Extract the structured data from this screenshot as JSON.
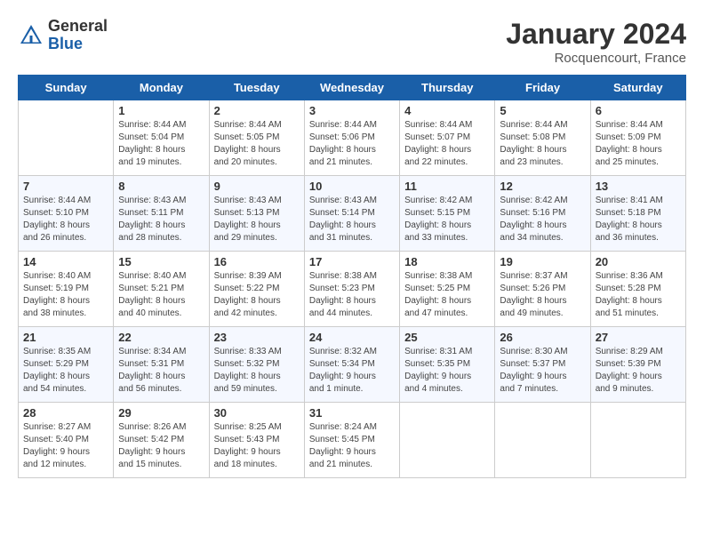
{
  "logo": {
    "general": "General",
    "blue": "Blue"
  },
  "title": "January 2024",
  "location": "Rocquencourt, France",
  "days_of_week": [
    "Sunday",
    "Monday",
    "Tuesday",
    "Wednesday",
    "Thursday",
    "Friday",
    "Saturday"
  ],
  "weeks": [
    [
      {
        "day": "",
        "info": ""
      },
      {
        "day": "1",
        "info": "Sunrise: 8:44 AM\nSunset: 5:04 PM\nDaylight: 8 hours\nand 19 minutes."
      },
      {
        "day": "2",
        "info": "Sunrise: 8:44 AM\nSunset: 5:05 PM\nDaylight: 8 hours\nand 20 minutes."
      },
      {
        "day": "3",
        "info": "Sunrise: 8:44 AM\nSunset: 5:06 PM\nDaylight: 8 hours\nand 21 minutes."
      },
      {
        "day": "4",
        "info": "Sunrise: 8:44 AM\nSunset: 5:07 PM\nDaylight: 8 hours\nand 22 minutes."
      },
      {
        "day": "5",
        "info": "Sunrise: 8:44 AM\nSunset: 5:08 PM\nDaylight: 8 hours\nand 23 minutes."
      },
      {
        "day": "6",
        "info": "Sunrise: 8:44 AM\nSunset: 5:09 PM\nDaylight: 8 hours\nand 25 minutes."
      }
    ],
    [
      {
        "day": "7",
        "info": ""
      },
      {
        "day": "8",
        "info": "Sunrise: 8:43 AM\nSunset: 5:11 PM\nDaylight: 8 hours\nand 28 minutes."
      },
      {
        "day": "9",
        "info": "Sunrise: 8:43 AM\nSunset: 5:13 PM\nDaylight: 8 hours\nand 29 minutes."
      },
      {
        "day": "10",
        "info": "Sunrise: 8:43 AM\nSunset: 5:14 PM\nDaylight: 8 hours\nand 31 minutes."
      },
      {
        "day": "11",
        "info": "Sunrise: 8:42 AM\nSunset: 5:15 PM\nDaylight: 8 hours\nand 33 minutes."
      },
      {
        "day": "12",
        "info": "Sunrise: 8:42 AM\nSunset: 5:16 PM\nDaylight: 8 hours\nand 34 minutes."
      },
      {
        "day": "13",
        "info": "Sunrise: 8:41 AM\nSunset: 5:18 PM\nDaylight: 8 hours\nand 36 minutes."
      }
    ],
    [
      {
        "day": "14",
        "info": ""
      },
      {
        "day": "15",
        "info": "Sunrise: 8:40 AM\nSunset: 5:21 PM\nDaylight: 8 hours\nand 40 minutes."
      },
      {
        "day": "16",
        "info": "Sunrise: 8:39 AM\nSunset: 5:22 PM\nDaylight: 8 hours\nand 42 minutes."
      },
      {
        "day": "17",
        "info": "Sunrise: 8:38 AM\nSunset: 5:23 PM\nDaylight: 8 hours\nand 44 minutes."
      },
      {
        "day": "18",
        "info": "Sunrise: 8:38 AM\nSunset: 5:25 PM\nDaylight: 8 hours\nand 47 minutes."
      },
      {
        "day": "19",
        "info": "Sunrise: 8:37 AM\nSunset: 5:26 PM\nDaylight: 8 hours\nand 49 minutes."
      },
      {
        "day": "20",
        "info": "Sunrise: 8:36 AM\nSunset: 5:28 PM\nDaylight: 8 hours\nand 51 minutes."
      }
    ],
    [
      {
        "day": "21",
        "info": ""
      },
      {
        "day": "22",
        "info": "Sunrise: 8:34 AM\nSunset: 5:31 PM\nDaylight: 8 hours\nand 56 minutes."
      },
      {
        "day": "23",
        "info": "Sunrise: 8:33 AM\nSunset: 5:32 PM\nDaylight: 8 hours\nand 59 minutes."
      },
      {
        "day": "24",
        "info": "Sunrise: 8:32 AM\nSunset: 5:34 PM\nDaylight: 9 hours\nand 1 minute."
      },
      {
        "day": "25",
        "info": "Sunrise: 8:31 AM\nSunset: 5:35 PM\nDaylight: 9 hours\nand 4 minutes."
      },
      {
        "day": "26",
        "info": "Sunrise: 8:30 AM\nSunset: 5:37 PM\nDaylight: 9 hours\nand 7 minutes."
      },
      {
        "day": "27",
        "info": "Sunrise: 8:29 AM\nSunset: 5:39 PM\nDaylight: 9 hours\nand 9 minutes."
      }
    ],
    [
      {
        "day": "28",
        "info": "Sunrise: 8:27 AM\nSunset: 5:40 PM\nDaylight: 9 hours\nand 12 minutes."
      },
      {
        "day": "29",
        "info": "Sunrise: 8:26 AM\nSunset: 5:42 PM\nDaylight: 9 hours\nand 15 minutes."
      },
      {
        "day": "30",
        "info": "Sunrise: 8:25 AM\nSunset: 5:43 PM\nDaylight: 9 hours\nand 18 minutes."
      },
      {
        "day": "31",
        "info": "Sunrise: 8:24 AM\nSunset: 5:45 PM\nDaylight: 9 hours\nand 21 minutes."
      },
      {
        "day": "",
        "info": ""
      },
      {
        "day": "",
        "info": ""
      },
      {
        "day": "",
        "info": ""
      }
    ]
  ],
  "week7_day14_info": "Sunrise: 8:40 AM\nSunset: 5:19 PM\nDaylight: 8 hours\nand 38 minutes.",
  "week7_day21_info": "Sunrise: 8:35 AM\nSunset: 5:29 PM\nDaylight: 8 hours\nand 54 minutes.",
  "week2_day7_info": "Sunrise: 8:44 AM\nSunset: 5:10 PM\nDaylight: 8 hours\nand 26 minutes."
}
